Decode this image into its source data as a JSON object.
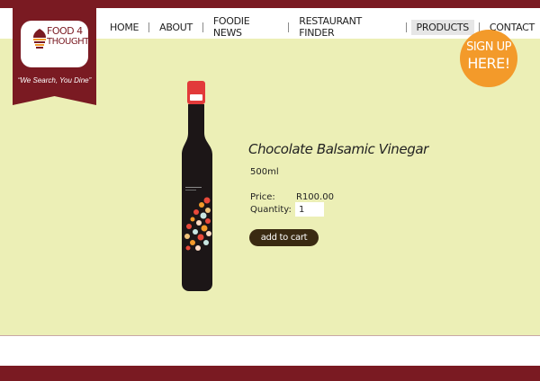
{
  "brand": {
    "logo_line1": "FOOD 4",
    "logo_line2": "THOUGHT",
    "tagline": "“We Search, You Dine”",
    "primary_color": "#7a1a22",
    "accent_color": "#f39a2a",
    "background_color": "#ecefb6"
  },
  "nav": {
    "items": [
      {
        "label": "HOME",
        "active": false
      },
      {
        "label": "ABOUT",
        "active": false
      },
      {
        "label": "FOODIE NEWS",
        "active": false
      },
      {
        "label": "RESTAURANT FINDER",
        "active": false
      },
      {
        "label": "PRODUCTS",
        "active": true
      },
      {
        "label": "CONTACT",
        "active": false
      }
    ]
  },
  "signup": {
    "line1": "SIGN UP",
    "line2": "HERE!"
  },
  "product": {
    "name": "Chocolate Balsamic Vinegar",
    "size": "500ml",
    "price_label": "Price:",
    "price_value": "R100.00",
    "quantity_label": "Quantity:",
    "quantity_value": "1",
    "add_to_cart_label": "add to cart",
    "bottle_label_text": "TRANSCRIPTS"
  }
}
